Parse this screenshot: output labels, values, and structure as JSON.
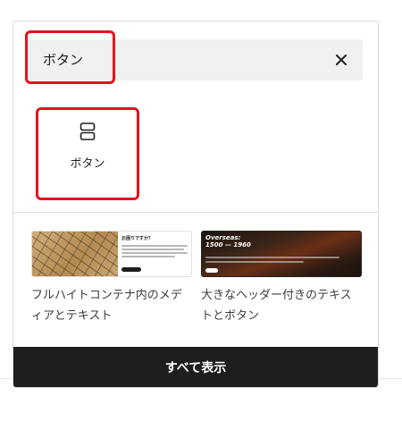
{
  "search": {
    "value": "ボタン"
  },
  "block": {
    "label": "ボタン",
    "icon": "buttons-block-icon"
  },
  "patterns": [
    {
      "title": "フルハイトコンテナ内のメディアとテキスト",
      "thumb_heading": "お困りですか？"
    },
    {
      "title": "大きなヘッダー付きのテキストとボタン",
      "thumb_heading": "Overseas: 1500 — 1960"
    }
  ],
  "footer": {
    "label": "すべて表示"
  },
  "colors": {
    "highlight": "#e0141e",
    "footer_bg": "#1e1e1e",
    "search_bg": "#f0f0f0"
  }
}
